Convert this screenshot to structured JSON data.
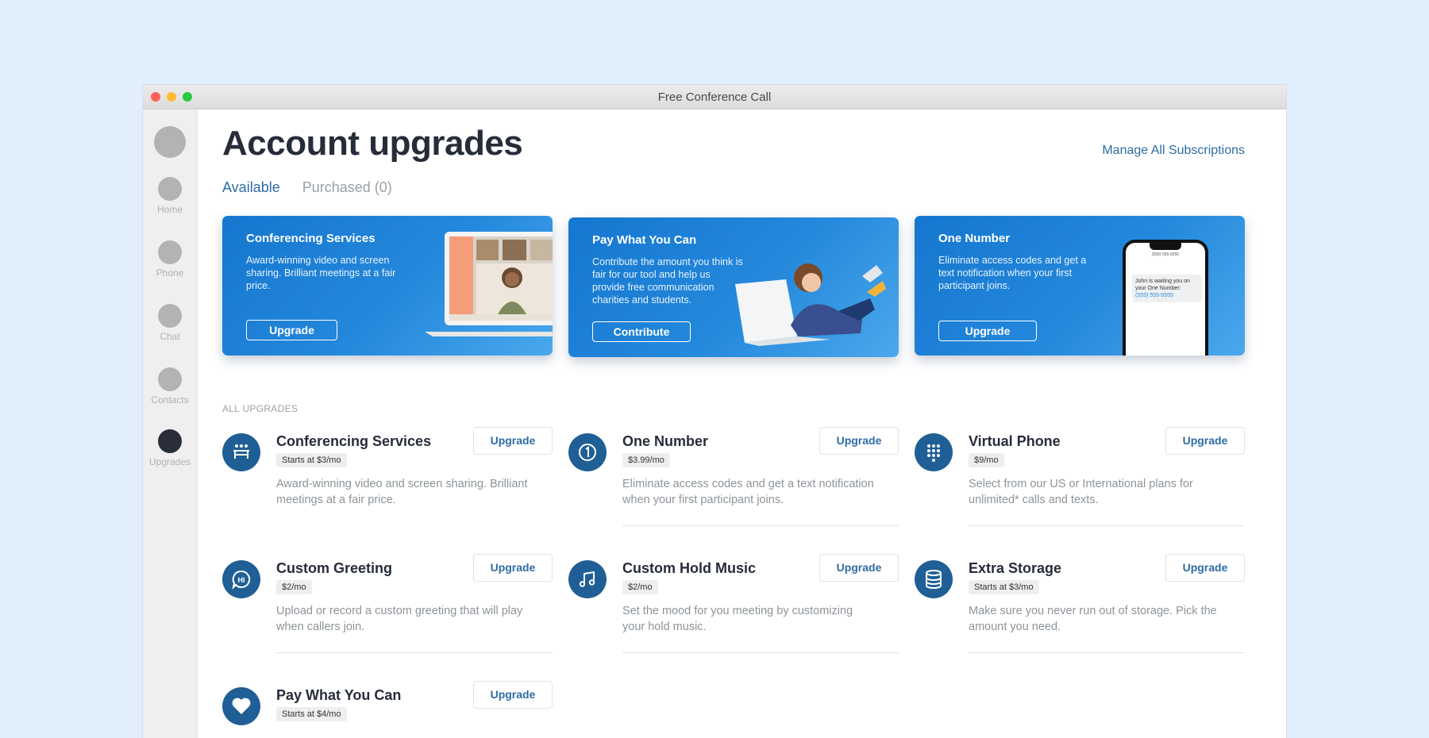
{
  "window": {
    "title": "Free Conference Call"
  },
  "sidebar": {
    "items": [
      {
        "label": "Home"
      },
      {
        "label": "Phone"
      },
      {
        "label": "Chat"
      },
      {
        "label": "Contacts"
      },
      {
        "label": "Upgrades",
        "active": true
      }
    ]
  },
  "header": {
    "title": "Account upgrades",
    "manage_link": "Manage All Subscriptions",
    "tabs": [
      {
        "label": "Available",
        "active": true
      },
      {
        "label": "Purchased (0)",
        "active": false
      }
    ]
  },
  "banners": [
    {
      "title": "Conferencing Services",
      "description": "Award-winning video and screen sharing. Brilliant meetings at a fair price.",
      "button": "Upgrade",
      "icon": "laptop-video-call-image"
    },
    {
      "title": "Pay What You Can",
      "description": "Contribute the amount you think is fair for our tool and help us provide free communication charities and students.",
      "button": "Contribute",
      "icon": "child-with-laptop-image"
    },
    {
      "title": "One Number",
      "description": "Eliminate access codes and get a text notification when your first participant joins.",
      "button": "Upgrade",
      "icon": "phone-notification-image",
      "phone_header": "(555) 555-5555",
      "phone_message": "John is waiting you on your One Number:",
      "phone_number": "(555) 555-5555"
    }
  ],
  "section_label": "ALL UPGRADES",
  "upgrades": [
    {
      "name": "Conferencing Services",
      "price": "Starts at $3/mo",
      "description": "Award-winning video and screen sharing. Brilliant meetings at a fair price.",
      "button": "Upgrade",
      "icon": "conference-table-icon"
    },
    {
      "name": "One Number",
      "price": "$3.99/mo",
      "description": "Eliminate access codes and get a text notification when your first participant joins.",
      "button": "Upgrade",
      "icon": "number-one-icon"
    },
    {
      "name": "Virtual Phone",
      "price": "$9/mo",
      "description": "Select from our US or International plans for unlimited* calls and texts.",
      "button": "Upgrade",
      "icon": "dialpad-icon"
    },
    {
      "name": "Custom Greeting",
      "price": "$2/mo",
      "description": "Upload or record a custom greeting that will play when callers join.",
      "button": "Upgrade",
      "icon": "greeting-bubble-icon",
      "icon_text": "HI"
    },
    {
      "name": "Custom Hold Music",
      "price": "$2/mo",
      "description": "Set the mood for you meeting by customizing your hold music.",
      "button": "Upgrade",
      "icon": "music-note-icon"
    },
    {
      "name": "Extra Storage",
      "price": "Starts at $3/mo",
      "description": "Make sure you never run out of storage. Pick the amount you need.",
      "button": "Upgrade",
      "icon": "database-icon"
    },
    {
      "name": "Pay What You Can",
      "price": "Starts at $4/mo",
      "description": "",
      "button": "Upgrade",
      "icon": "heart-icon"
    }
  ],
  "colors": {
    "background": "#e0effb",
    "accent": "#2e6ca4",
    "icon_circle": "#1f5f95",
    "banner_blue": "#1577cf",
    "heading": "#262c3a"
  }
}
